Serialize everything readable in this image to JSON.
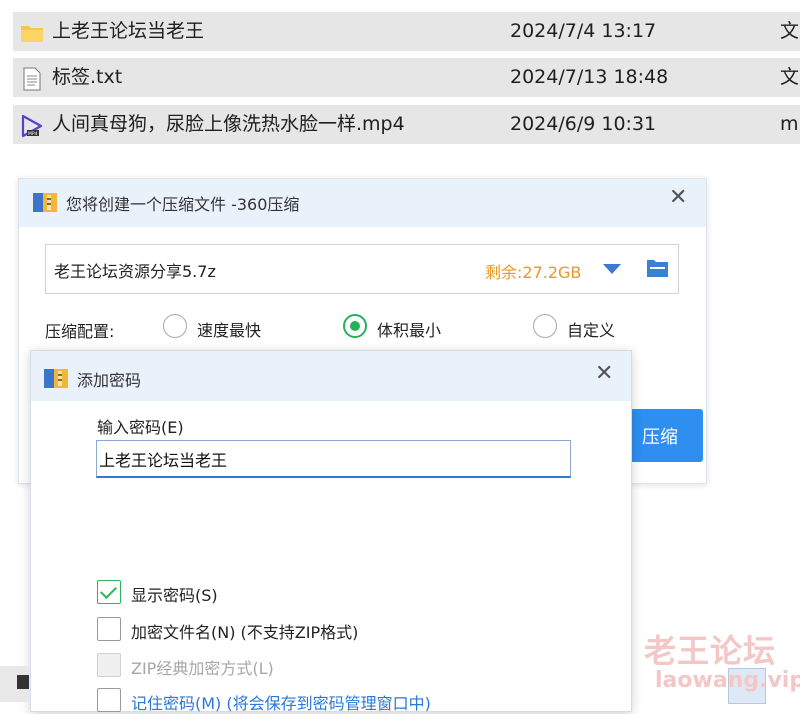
{
  "files": [
    {
      "name": "上老王论坛当老王",
      "date": "2024/7/4 13:17",
      "type": "文",
      "icon": "folder-icon"
    },
    {
      "name": "标签.txt",
      "date": "2024/7/13 18:48",
      "type": "文",
      "icon": "text-file-icon"
    },
    {
      "name": "人间真母狗，尿脸上像洗热水脸一样.mp4",
      "date": "2024/6/9 10:31",
      "type": "m",
      "icon": "video-file-icon"
    }
  ],
  "compress_dialog": {
    "title": "您将创建一个压缩文件 -360压缩",
    "filename": "老王论坛资源分享5.7z",
    "free_space": "剩余:27.2GB",
    "config_label": "压缩配置:",
    "options": [
      "速度最快",
      "体积最小",
      "自定义"
    ],
    "selected_option": "体积最小",
    "button_label": "压缩"
  },
  "password_dialog": {
    "title": "添加密码",
    "input_label": "输入密码(E)",
    "password_value": "上老王论坛当老王",
    "checkboxes": [
      {
        "label": "显示密码(S)",
        "checked": true,
        "disabled": false
      },
      {
        "label": "加密文件名(N) (不支持ZIP格式)",
        "checked": false,
        "disabled": false
      },
      {
        "label": "ZIP经典加密方式(L)",
        "checked": false,
        "disabled": true
      },
      {
        "label": "记住密码(M) (将会保存到密码管理窗口中)",
        "checked": false,
        "disabled": false
      }
    ]
  },
  "watermark": {
    "text": "老王论坛",
    "url": "laowang.vip"
  },
  "colors": {
    "accent": "#2e8ff0",
    "selected_green": "#25b15a",
    "free_space": "#e69a28",
    "titlebar": "#e9f1fb"
  }
}
